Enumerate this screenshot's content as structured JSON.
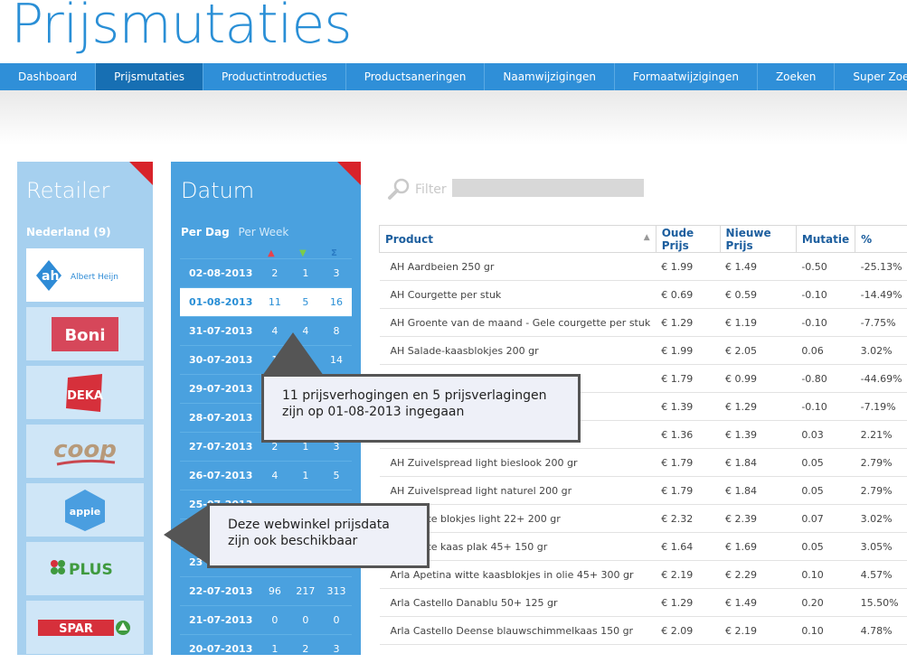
{
  "page_title": "Prijsmutaties",
  "nav": [
    {
      "label": "Dashboard",
      "active": false
    },
    {
      "label": "Prijsmutaties",
      "active": true
    },
    {
      "label": "Productintroducties",
      "active": false
    },
    {
      "label": "Productsaneringen",
      "active": false
    },
    {
      "label": "Naamwijzigingen",
      "active": false
    },
    {
      "label": "Formaatwijzigingen",
      "active": false
    },
    {
      "label": "Zoeken",
      "active": false
    },
    {
      "label": "Super Zoeken",
      "active": false
    }
  ],
  "retailer": {
    "heading": "Retailer",
    "country": "Nederland (9)",
    "logos": [
      {
        "name": "albert-heijn-logo",
        "text": "Albert Heijn"
      },
      {
        "name": "boni-logo",
        "text": "Boni"
      },
      {
        "name": "deka-logo",
        "text": "DEKA"
      },
      {
        "name": "coop-logo",
        "text": "coop"
      },
      {
        "name": "appie-logo",
        "text": "appie"
      },
      {
        "name": "plus-logo",
        "text": "PLUS"
      },
      {
        "name": "spar-logo",
        "text": "SPAR"
      }
    ]
  },
  "datum": {
    "heading": "Datum",
    "tab_day": "Per Dag",
    "tab_week": "Per Week",
    "rows": [
      {
        "date": "02-08-2013",
        "up": "2",
        "down": "1",
        "total": "3",
        "selected": false
      },
      {
        "date": "01-08-2013",
        "up": "11",
        "down": "5",
        "total": "16",
        "selected": true
      },
      {
        "date": "31-07-2013",
        "up": "4",
        "down": "4",
        "total": "8",
        "selected": false
      },
      {
        "date": "30-07-2013",
        "up": "1",
        "down": "",
        "total": "14",
        "selected": false
      },
      {
        "date": "29-07-2013",
        "up": "",
        "down": "",
        "total": "",
        "selected": false
      },
      {
        "date": "28-07-2013",
        "up": "",
        "down": "",
        "total": "",
        "selected": false
      },
      {
        "date": "27-07-2013",
        "up": "2",
        "down": "1",
        "total": "3",
        "selected": false
      },
      {
        "date": "26-07-2013",
        "up": "4",
        "down": "1",
        "total": "5",
        "selected": false
      },
      {
        "date": "25-07-2013",
        "up": "",
        "down": "",
        "total": "",
        "selected": false
      },
      {
        "date": "",
        "up": "",
        "down": "",
        "total": "",
        "selected": false
      },
      {
        "date": "23",
        "up": "",
        "down": "",
        "total": "",
        "selected": false
      },
      {
        "date": "22-07-2013",
        "up": "96",
        "down": "217",
        "total": "313",
        "selected": false
      },
      {
        "date": "21-07-2013",
        "up": "0",
        "down": "0",
        "total": "0",
        "selected": false
      },
      {
        "date": "20-07-2013",
        "up": "1",
        "down": "2",
        "total": "3",
        "selected": false
      }
    ]
  },
  "filter": {
    "label": "Filter",
    "value": ""
  },
  "table": {
    "headers": [
      "Product",
      "Oude Prijs",
      "Nieuwe Prijs",
      "Mutatie",
      "%"
    ],
    "rows": [
      [
        "AH Aardbeien 250 gr",
        "€ 1.99",
        "€ 1.49",
        "-0.50",
        "-25.13%"
      ],
      [
        "AH Courgette per stuk",
        "€ 0.69",
        "€ 0.59",
        "-0.10",
        "-14.49%"
      ],
      [
        "AH Groente van de maand - Gele courgette per stuk",
        "€ 1.29",
        "€ 1.19",
        "-0.10",
        "-7.75%"
      ],
      [
        "AH Salade-kaasblokjes 200 gr",
        "€ 1.99",
        "€ 2.05",
        "0.06",
        "3.02%"
      ],
      [
        "",
        "€ 1.79",
        "€ 0.99",
        "-0.80",
        "-44.69%"
      ],
      [
        "",
        "€ 1.39",
        "€ 1.29",
        "-0.10",
        "-7.19%"
      ],
      [
        "",
        "€ 1.36",
        "€ 1.39",
        "0.03",
        "2.21%"
      ],
      [
        "AH Zuivelspread light bieslook 200 gr",
        "€ 1.79",
        "€ 1.84",
        "0.05",
        "2.79%"
      ],
      [
        "AH Zuivelspread light naturel 200 gr",
        "€ 1.79",
        "€ 1.84",
        "0.05",
        "2.79%"
      ],
      [
        "tina witte blokjes light 22+ 200 gr",
        "€ 2.32",
        "€ 2.39",
        "0.07",
        "3.02%"
      ],
      [
        "tina witte kaas plak 45+ 150 gr",
        "€ 1.64",
        "€ 1.69",
        "0.05",
        "3.05%"
      ],
      [
        "Arla Apetina witte kaasblokjes in olie 45+ 300 gr",
        "€ 2.19",
        "€ 2.29",
        "0.10",
        "4.57%"
      ],
      [
        "Arla Castello Danablu 50+ 125 gr",
        "€ 1.29",
        "€ 1.49",
        "0.20",
        "15.50%"
      ],
      [
        "Arla Castello Deense blauwschimmelkaas 150 gr",
        "€ 2.09",
        "€ 2.19",
        "0.10",
        "4.78%"
      ]
    ]
  },
  "callouts": {
    "date_callout_line1": "11 prijsverhogingen en 5 prijsverlagingen",
    "date_callout_line2": "zijn op 01-08-2013 ingegaan",
    "store_callout_line1": "Deze webwinkel prijsdata",
    "store_callout_line2": "zijn ook beschikbaar"
  }
}
